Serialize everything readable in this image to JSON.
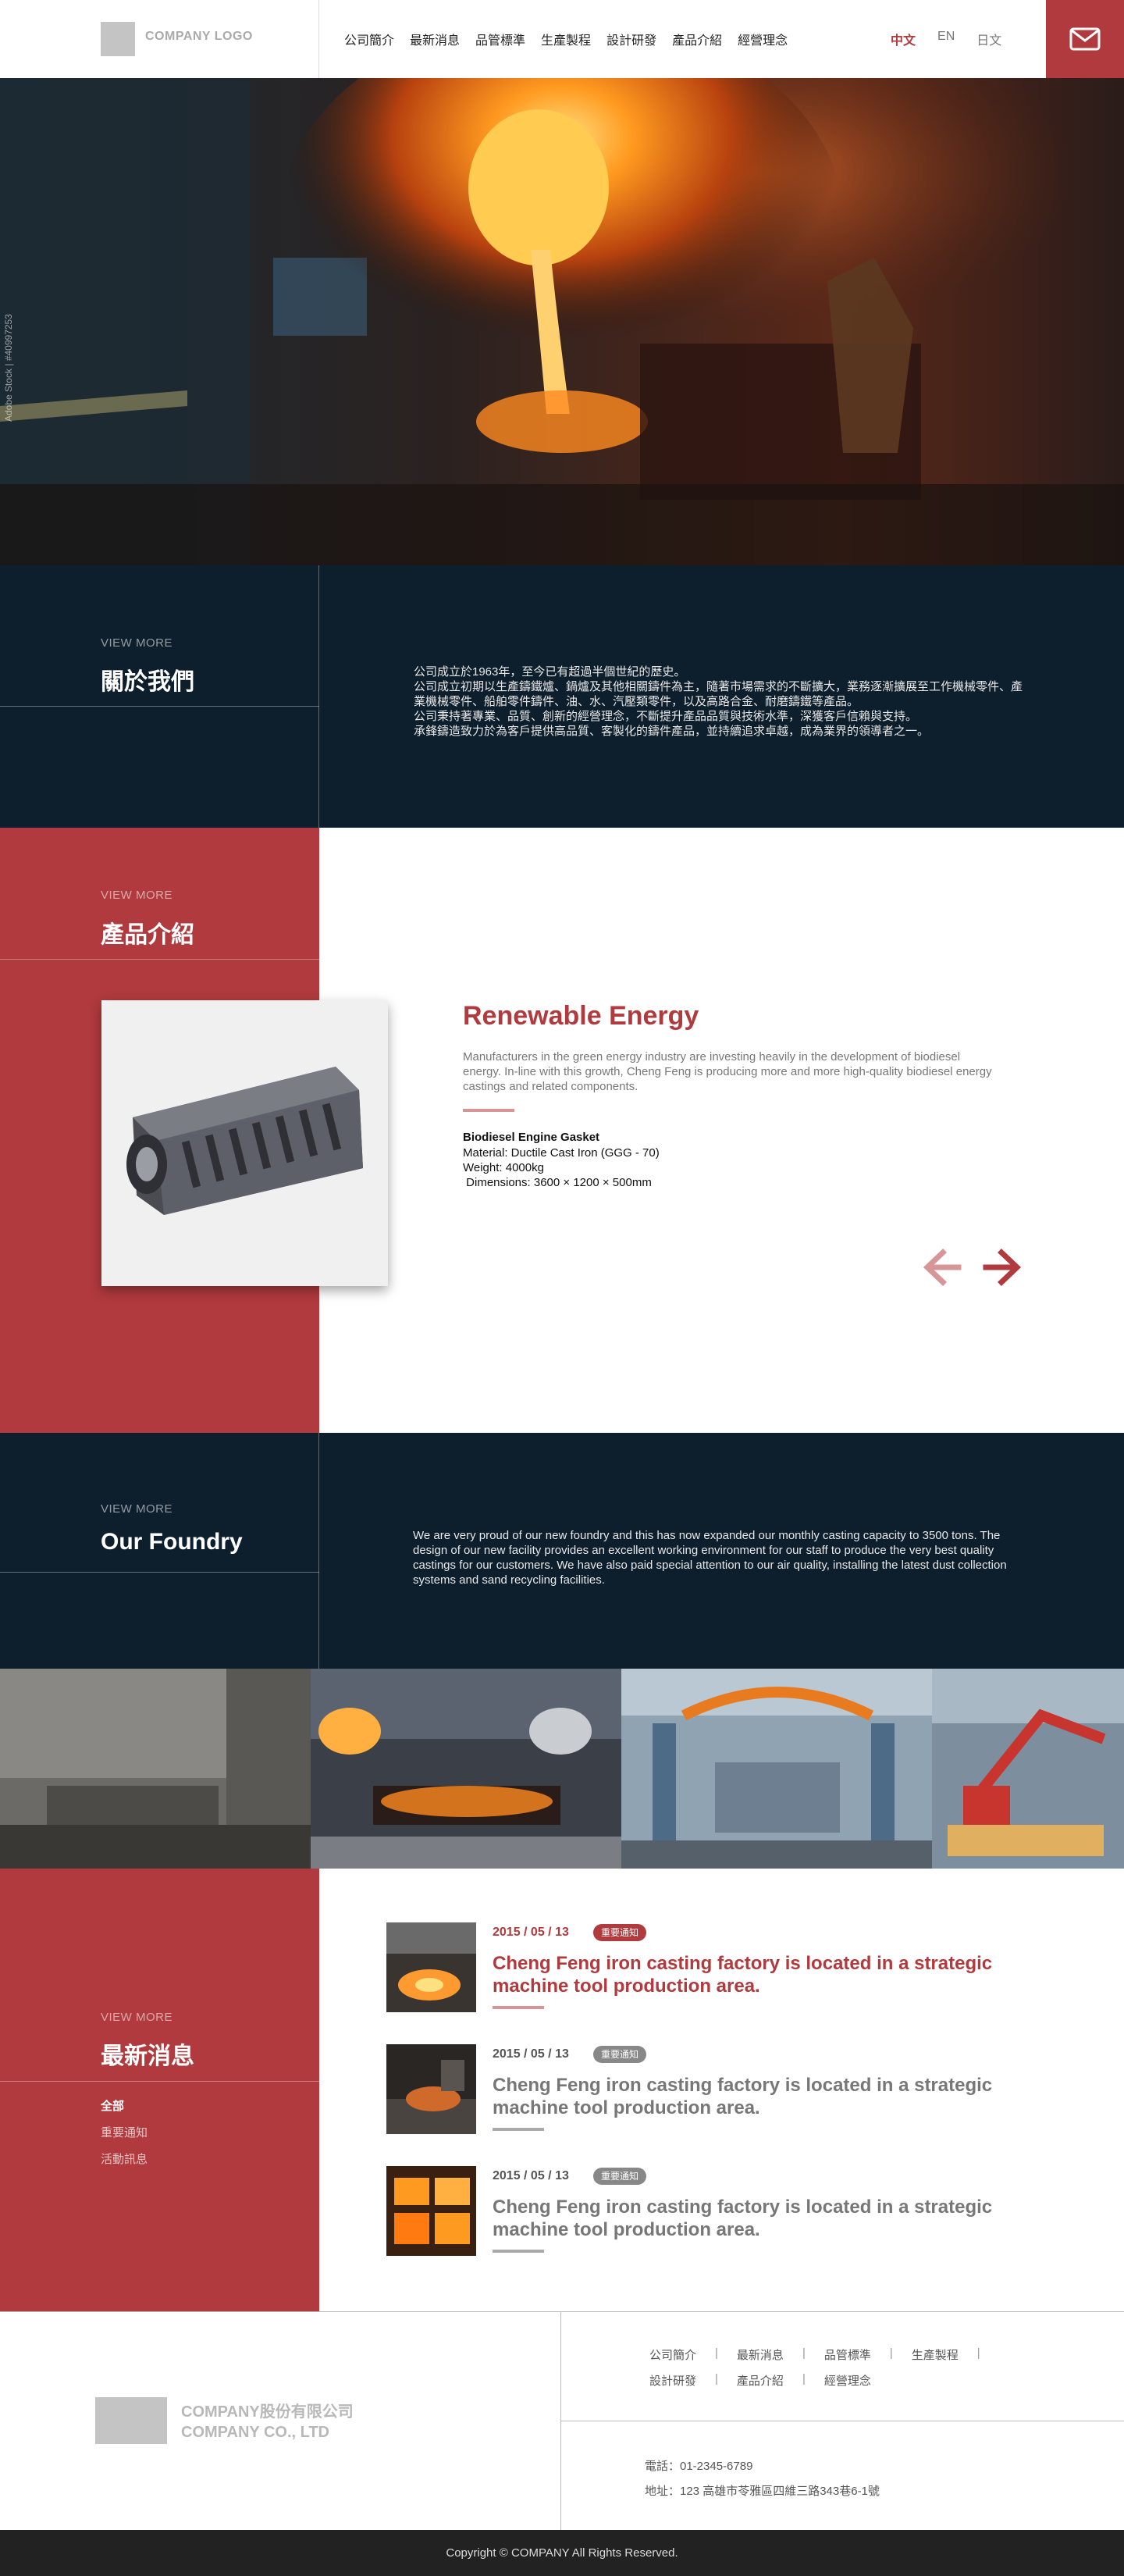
{
  "header": {
    "logo_text": "COMPANY LOGO",
    "nav": [
      "公司簡介",
      "最新消息",
      "品管標準",
      "生產製程",
      "設計研發",
      "產品介紹",
      "經營理念"
    ],
    "langs": [
      "中文",
      "EN",
      "日文"
    ],
    "active_lang": "中文"
  },
  "hero": {
    "watermark": "Adobe Stock | #40997253"
  },
  "about": {
    "view_more": "VIEW MORE",
    "title": "關於我們",
    "text": "公司成立於1963年，至今已有超過半個世紀的歷史。\n公司成立初期以生產鑄鐵爐、鍋爐及其他相關鑄件為主，隨著市場需求的不斷擴大，業務逐漸擴展至工作機械零件、產業機械零件、船舶零件鑄件、油、水、汽壓類零件，以及高路合金、耐磨鑄鐵等產品。\n公司秉持著專業、品質、創新的經營理念，不斷提升產品品質與技術水準，深獲客戶信賴與支持。\n承鋒鑄造致力於為客戶提供高品質、客製化的鑄件產品，並持續追求卓越，成為業界的領導者之一。"
  },
  "products": {
    "view_more": "VIEW MORE",
    "title": "產品介紹",
    "item_title": "Renewable Energy",
    "item_desc": "Manufacturers in the green energy industry are investing heavily in the development of biodiesel energy. In-line with this growth, Cheng Feng is producing more and more high-quality biodiesel energy castings and related components.",
    "spec_title": "Biodiesel Engine Gasket",
    "spec_lines": "Material: Ductile Cast Iron (GGG - 70)\nWeight: 4000kg\n Dimensions: 3600 × 1200 × 500mm"
  },
  "foundry": {
    "view_more": "VIEW MORE",
    "title": "Our Foundry",
    "text": "We are very proud of our new foundry and this has now expanded our monthly casting capacity to 3500 tons. The design of our new facility provides an excellent working environment for our staff to produce the very best quality castings for our customers. We have also paid special attention to our air quality, installing the latest dust collection systems and sand recycling facilities."
  },
  "news": {
    "view_more": "VIEW MORE",
    "title": "最新消息",
    "filters": [
      "全部",
      "重要通知",
      "活動訊息"
    ],
    "items": [
      {
        "date": "2015 / 05 / 13",
        "tag": "重要通知",
        "title": "Cheng Feng iron casting factory is located in a strategic machine tool production area."
      },
      {
        "date": "2015 / 05 / 13",
        "tag": "重要通知",
        "title": "Cheng Feng iron casting factory is located in a strategic machine tool production area."
      },
      {
        "date": "2015 / 05 / 13",
        "tag": "重要通知",
        "title": "Cheng Feng iron casting factory is located in a strategic machine tool production area."
      }
    ]
  },
  "footer": {
    "company_zh": "COMPANY股份有限公司",
    "company_en": "COMPANY CO., LTD",
    "nav_row1": [
      "公司簡介",
      "最新消息",
      "品管標準",
      "生產製程"
    ],
    "nav_row2": [
      "設計研發",
      "產品介紹",
      "經營理念"
    ],
    "phone": "電話：01-2345-6789",
    "address": "地址：123 高雄市苓雅區四維三路343巷6-1號",
    "copyright": "Copyright © COMPANY All Rights Reserved."
  },
  "colors": {
    "accent": "#b03a3d",
    "dark": "#0d1e2c"
  }
}
